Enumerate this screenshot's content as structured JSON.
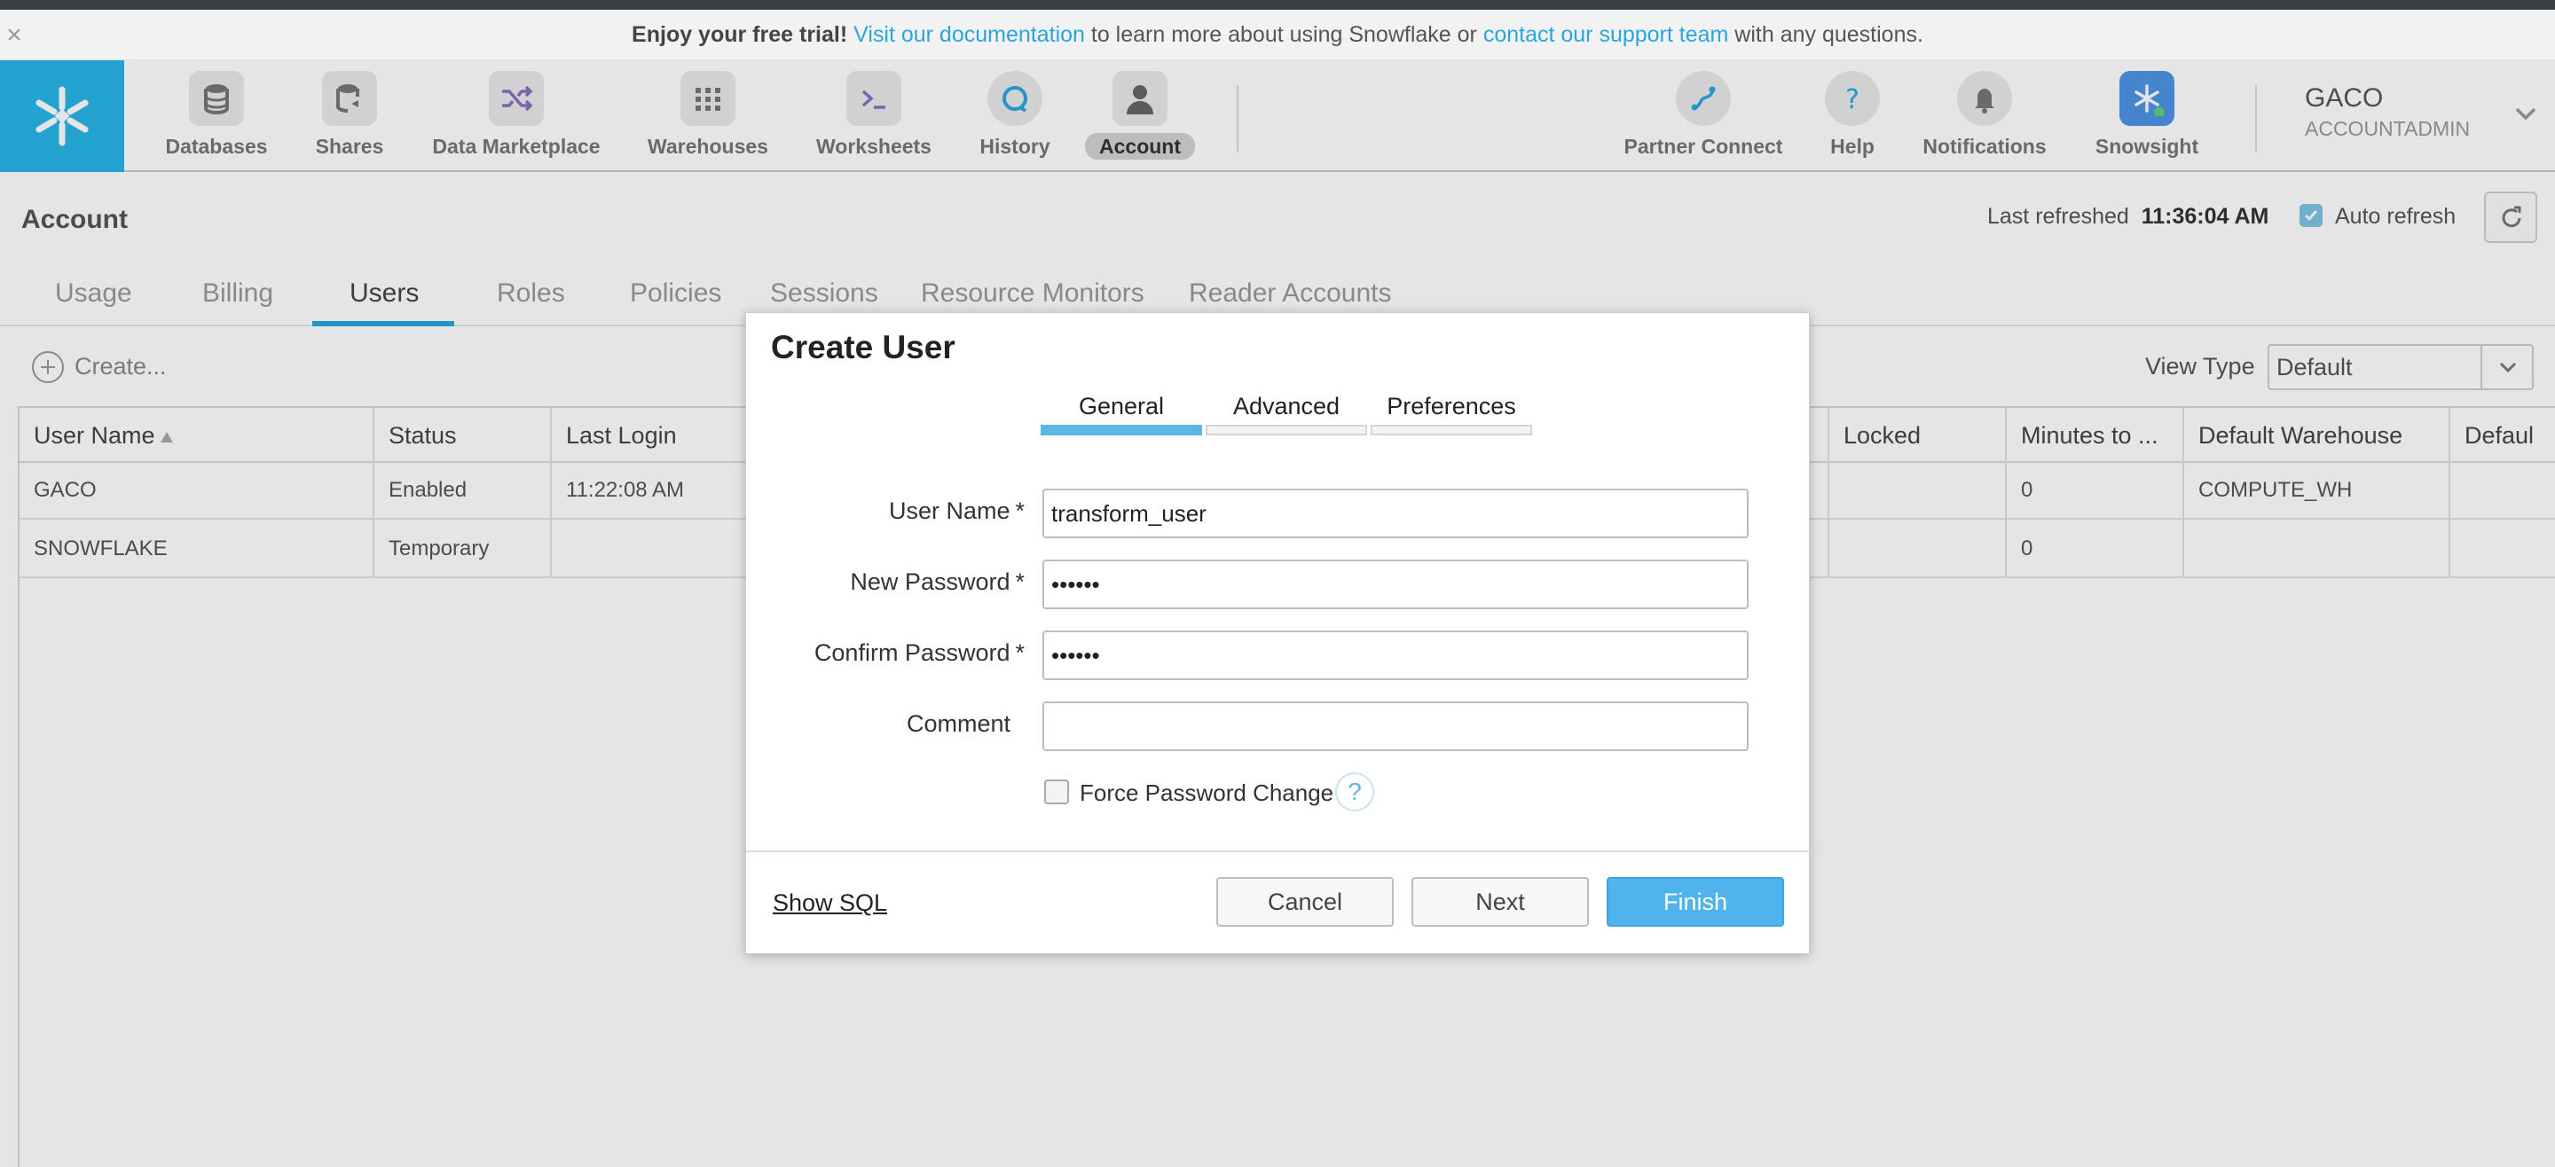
{
  "banner": {
    "strong": "Enjoy your free trial!",
    "link1": "Visit our documentation",
    "mid": " to learn more about using Snowflake or ",
    "link2": "contact our support team",
    "end": " with any questions.",
    "close": "×"
  },
  "nav": {
    "items": [
      {
        "label": "Databases",
        "icon": "database-icon"
      },
      {
        "label": "Shares",
        "icon": "shares-icon"
      },
      {
        "label": "Data Marketplace",
        "icon": "shuffle-icon"
      },
      {
        "label": "Warehouses",
        "icon": "grid-icon"
      },
      {
        "label": "Worksheets",
        "icon": "terminal-icon"
      },
      {
        "label": "History",
        "icon": "history-icon"
      },
      {
        "label": "Account",
        "icon": "person-icon",
        "active": true
      }
    ],
    "right_items": [
      {
        "label": "Partner Connect",
        "icon": "link-icon"
      },
      {
        "label": "Help",
        "icon": "help-icon"
      },
      {
        "label": "Notifications",
        "icon": "bell-icon"
      },
      {
        "label": "Snowsight",
        "icon": "snowsight-icon"
      }
    ],
    "user": {
      "name": "GACO",
      "role": "ACCOUNTADMIN"
    }
  },
  "account": {
    "title": "Account",
    "last_refreshed_label": "Last refreshed",
    "last_refreshed_time": "11:36:04 AM",
    "auto_refresh_label": "Auto refresh",
    "auto_refresh_checked": true
  },
  "tabs": [
    "Usage",
    "Billing",
    "Users",
    "Roles",
    "Policies",
    "Sessions",
    "Resource Monitors",
    "Reader Accounts"
  ],
  "active_tab": "Users",
  "toolbar": {
    "create_label": "Create...",
    "view_type_label": "View Type",
    "view_type_value": "Default"
  },
  "table": {
    "headers": [
      "User Name",
      "Status",
      "Last Login",
      "Locked",
      "Minutes to ...",
      "Default Warehouse",
      "Defaul"
    ],
    "rows": [
      {
        "user_name": "GACO",
        "status": "Enabled",
        "last_login": "11:22:08 AM",
        "locked": "",
        "minutes": "0",
        "warehouse": "COMPUTE_WH"
      },
      {
        "user_name": "SNOWFLAKE",
        "status": "Temporary",
        "last_login": "",
        "locked": "",
        "minutes": "0",
        "warehouse": ""
      }
    ]
  },
  "dialog": {
    "title": "Create User",
    "tabs": [
      "General",
      "Advanced",
      "Preferences"
    ],
    "active_tab": "General",
    "fields": {
      "user_name_label": "User Name",
      "user_name_value": "transform_user",
      "new_password_label": "New Password",
      "new_password_value": "••••••",
      "confirm_password_label": "Confirm Password",
      "confirm_password_value": "••••••",
      "comment_label": "Comment",
      "comment_value": "",
      "required_mark": "*"
    },
    "force_password_change_label": "Force Password Change",
    "force_password_change_checked": false,
    "help_glyph": "?",
    "show_sql_label": "Show SQL",
    "cancel_label": "Cancel",
    "next_label": "Next",
    "finish_label": "Finish"
  },
  "colors": {
    "accent": "#29a5e0",
    "logo_bg": "#29b5e8",
    "finish_button": "#4fb3ec"
  }
}
